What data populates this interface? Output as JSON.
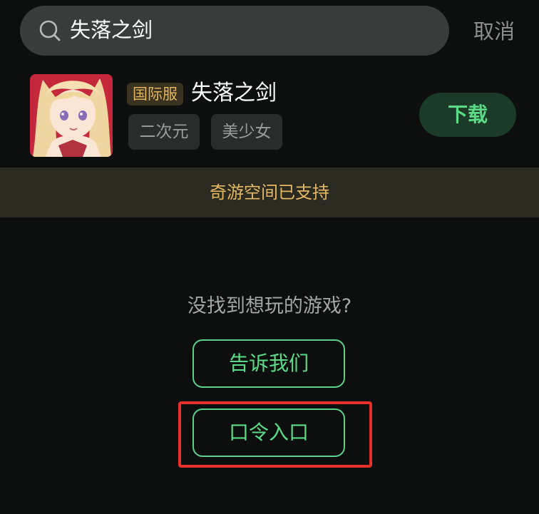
{
  "search": {
    "query": "失落之剑",
    "cancel_label": "取消",
    "icon": "search-icon"
  },
  "game": {
    "server_badge": "国际服",
    "title": "失落之剑",
    "tags": [
      "二次元",
      "美少女"
    ],
    "download_label": "下载",
    "icon": "anime-girl-game-icon"
  },
  "notice": {
    "text": "奇游空间已支持"
  },
  "empty_state": {
    "prompt": "没找到想玩的游戏?",
    "tell_us_label": "告诉我们",
    "code_entry_label": "口令入口"
  },
  "colors": {
    "background": "#0d0f0e",
    "accent_green": "#5cdb87",
    "notice_gold": "#e4b863",
    "highlight_red": "#e8302a"
  }
}
